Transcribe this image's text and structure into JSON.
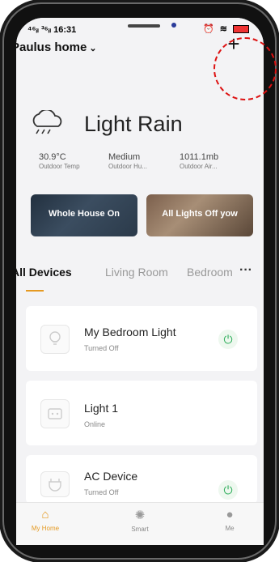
{
  "status_bar": {
    "signal": "⁴⁶ᵢₗ ³⁶ᵢₗ",
    "time": "16:31",
    "icons": "⏰ ≋"
  },
  "header": {
    "home_name": "Paulus home",
    "add_symbol": "+"
  },
  "weather": {
    "condition": "Light Rain",
    "stats": [
      {
        "value": "30.9°C",
        "label": "Outdoor Temp"
      },
      {
        "value": "Medium",
        "label": "Outdoor Hu..."
      },
      {
        "value": "1011.1mb",
        "label": "Outdoor Air..."
      }
    ]
  },
  "scenes": [
    {
      "label": "Whole House On"
    },
    {
      "label": "All Lights Off yow"
    }
  ],
  "tabs": [
    {
      "label": "All Devices"
    },
    {
      "label": "Living Room"
    },
    {
      "label": "Bedroom"
    }
  ],
  "more_symbol": "···",
  "devices": [
    {
      "name": "My Bedroom Light",
      "status": "Turned Off",
      "icon": "bulb-icon",
      "has_power": true
    },
    {
      "name": "Light 1",
      "status": "Online",
      "icon": "switch-icon",
      "has_power": false
    },
    {
      "name": "AC Device",
      "status": "Turned Off",
      "icon": "plug-icon",
      "has_power": true
    }
  ],
  "power_symbol": "⏻",
  "tabbar": [
    {
      "label": "My Home",
      "icon": "home-icon",
      "glyph": "⌂",
      "active": true
    },
    {
      "label": "Smart",
      "icon": "sun-icon",
      "glyph": "✺",
      "active": false
    },
    {
      "label": "Me",
      "icon": "user-icon",
      "glyph": "●",
      "active": false
    }
  ],
  "colors": {
    "accent": "#e59a22",
    "power_green": "#2fae5b",
    "highlight_circle": "#d11111"
  }
}
